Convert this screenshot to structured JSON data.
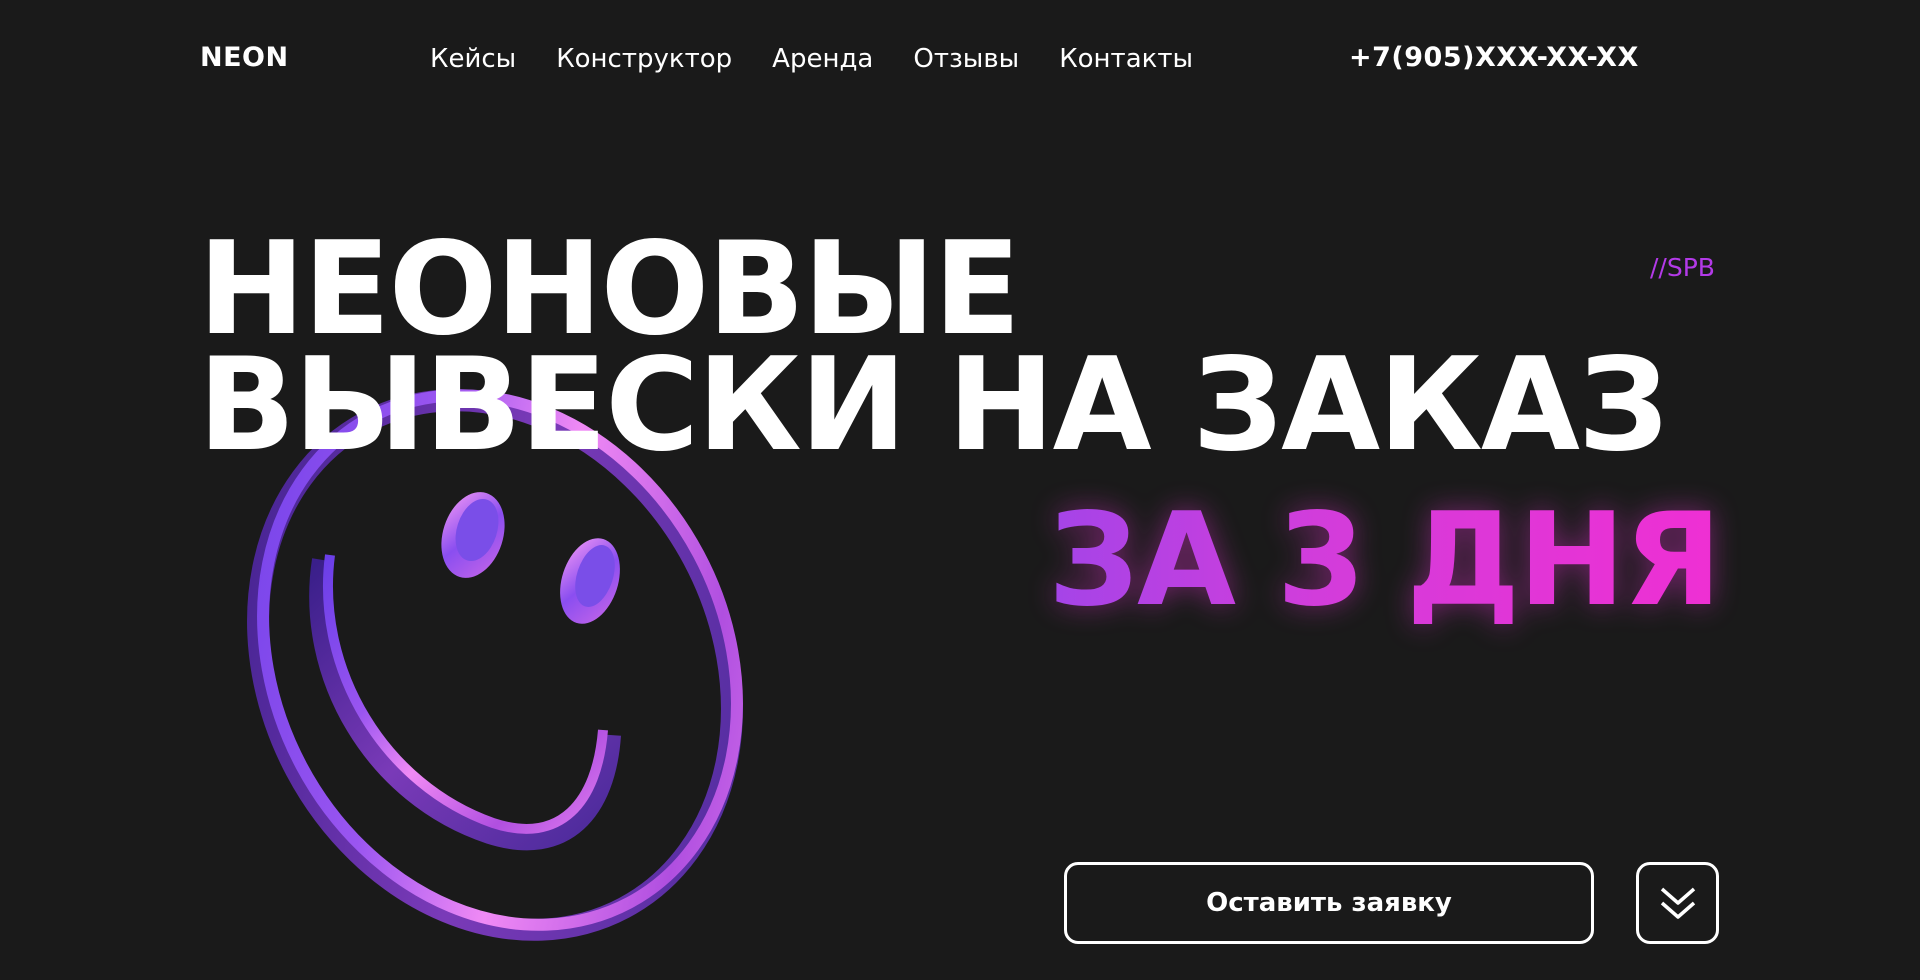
{
  "header": {
    "logo": "NEON",
    "nav": [
      {
        "label": "Кейсы"
      },
      {
        "label": "Конструктор"
      },
      {
        "label": "Аренда"
      },
      {
        "label": "Отзывы"
      },
      {
        "label": "Контакты"
      }
    ],
    "phone": "+7(905)XXX-XX-XX"
  },
  "hero": {
    "tag": "//SPB",
    "headline_line1": "НЕОНОВЫЕ",
    "headline_line2": "ВЫВЕСКИ НА ЗАКАЗ",
    "highlight": "ЗА 3 ДНЯ",
    "cta_label": "Оставить заявку",
    "scroll_icon": "double-chevron-down-icon",
    "illustration": "neon-smiley-icon"
  },
  "colors": {
    "background": "#1a1a1a",
    "text": "#ffffff",
    "accent_purple": "#a444e8",
    "accent_pink": "#ef2fd3"
  }
}
